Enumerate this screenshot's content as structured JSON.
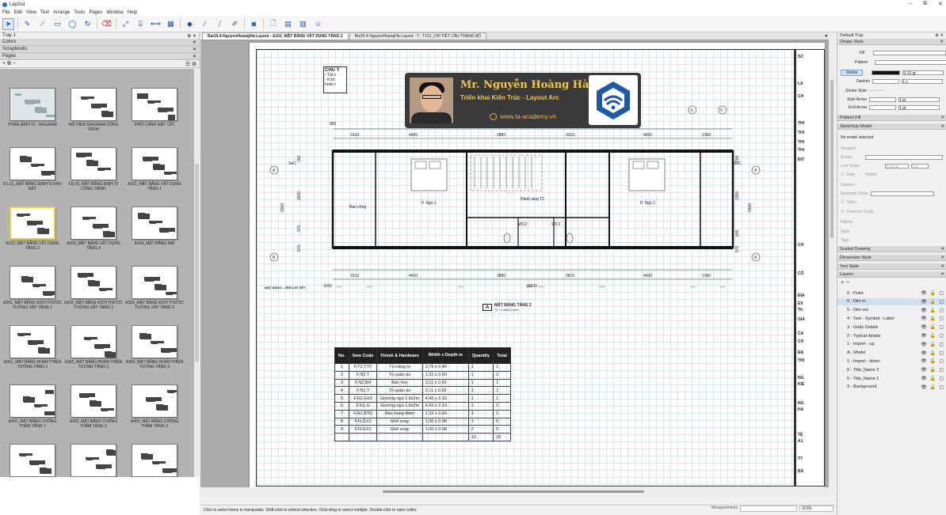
{
  "app": {
    "title": "LayOut"
  },
  "window_controls": {
    "minimize": "–",
    "restore": "⧉",
    "close": "✕"
  },
  "menu": [
    "File",
    "Edit",
    "View",
    "Text",
    "Arrange",
    "Tools",
    "Pages",
    "Window",
    "Help"
  ],
  "toolbar_icons": [
    "select-tool",
    "pencil-tool",
    "line-tool",
    "rectangle-tool",
    "circle-tool",
    "rotate-tool",
    "eraser-tool",
    "scale-tool",
    "label-tool",
    "dimension-tool",
    "table-tool",
    "style-tool",
    "sample-tool",
    "fill-tool",
    "paint-tool",
    "screen-tool",
    "add-page",
    "document",
    "document-2",
    "user-tool"
  ],
  "left_tray": {
    "title": "Tray 1",
    "sections": {
      "colors": "Colors",
      "scrapbooks": "Scrapbooks",
      "pages": "Pages"
    },
    "pages": [
      {
        "label": "PHÂN ĐỊNH VỊ - DIAGRAM"
      },
      {
        "label": "MÔ HÌNH DIAGRAM CÔNG TRÌNH"
      },
      {
        "label": "PHỐI CẢNH MẶT CẮT"
      },
      {
        "label": "D1.01_MẶT BẰNG ĐỊNH VỊ KHU ĐẤT"
      },
      {
        "label": "D2.01_MẶT BẰNG ĐỊNH VỊ CÔNG TRÌNH"
      },
      {
        "label": "A101_MẶT BẰNG VẬT DỤNG TẦNG 1"
      },
      {
        "label": "A102_MẶT BẰNG VẬT DỤNG TẦNG 2"
      },
      {
        "label": "A103_MẶT BẰNG VẬT DỤNG TẦNG 3"
      },
      {
        "label": "A104_MẶT BẰNG MÁI"
      },
      {
        "label": "A201_MẶT BẰNG KÍCH THƯỚC TƯỜNG XÂY TẦNG 1"
      },
      {
        "label": "A202_MẶT BẰNG KÍCH THƯỚC TƯỜNG XÂY TẦNG 2"
      },
      {
        "label": "A203_MẶT BẰNG KÍCH THƯỚC TƯỜNG XÂY TẦNG 3"
      },
      {
        "label": "A301_MẶT BẰNG HOÀN THIỆN TƯỜNG TẦNG 1"
      },
      {
        "label": "A302_MẶT BẰNG HOÀN THIỆN TƯỜNG TẦNG 2"
      },
      {
        "label": "A303_MẶT BẰNG HOÀN THIỆN TƯỜNG TẦNG 3"
      },
      {
        "label": "A401_MẶT BẰNG CHỐNG THẤM TẦNG 1"
      },
      {
        "label": "A402_MẶT BẰNG CHỐNG THẤM TẦNG 2"
      },
      {
        "label": "A403_MẶT BẰNG CHỐNG THẤM TẦNG 3"
      },
      {
        "label": ""
      },
      {
        "label": ""
      },
      {
        "label": ""
      }
    ]
  },
  "tabs": [
    {
      "label": "Bai15.4-NguyenHoangHa-Layout - A102_MẶT BẰNG VẬT DỤNG TẦNG 2"
    },
    {
      "label": "Bai15.4-NguyenHoangHa-Layout - T - T101_CHI TIẾT CẦU THANG BỘ"
    }
  ],
  "banner": {
    "name": "Mr. Nguyễn Hoàng Hà",
    "subtitle": "Triển khai Kiến Trúc - Layout Arc",
    "website": "www.ta-academy.vn"
  },
  "chu_y": {
    "title": "CHÚ Ý",
    "lines": [
      "- Tất c",
      "- Kích",
      "hoàn t"
    ]
  },
  "plan": {
    "top_dims": [
      "1510",
      "4420",
      "3880",
      "3010",
      "4420",
      "1360"
    ],
    "bottom_dims": [
      "1510",
      "4420",
      "3880",
      "3810",
      "4420",
      "1360"
    ],
    "total_left": "860",
    "total_top": "18600",
    "total_bottom": "18600",
    "total_left_bottom": "1160",
    "left_dims": [
      "750",
      "2600",
      "970",
      "570"
    ],
    "right_dims": [
      "600",
      "3360",
      "600",
      "570"
    ],
    "right_total": "5500",
    "left_total": "5500",
    "grid_top": [
      "5",
      "6",
      "6'"
    ],
    "grid_bottom": [
      "2'",
      "2",
      "3",
      "4",
      "5",
      "6",
      "6'"
    ],
    "rows": [
      "A",
      "B"
    ],
    "rooms": {
      "bedroom1": "P. Ngủ 1",
      "bedroom2": "P. Ngủ 2",
      "wc2": "WC2",
      "wc3": "WC3",
      "hallway": "Hành lang T2",
      "balcony": "Ban công",
      "section": "SeC"
    },
    "side_note": "MẶT BẰNG - XEM CHI TIẾT",
    "plan_title_letter": "A",
    "plan_title": "MẶT BẰNG TẦNG 2",
    "plan_scale": "TL: 1 over(1) mm"
  },
  "table": {
    "headers": [
      "No.",
      "Item Code",
      "Finish & Hardware",
      "Width x Depth m",
      "Quantity",
      "Total"
    ],
    "rows": [
      [
        "1",
        "F.T2.TTT",
        "Tủ trang trí",
        "2.76 x 0.40",
        "1",
        "1"
      ],
      [
        "2",
        "F.N2.T",
        "Tủ quần áo",
        "1.31 x 0.60",
        "1",
        "2"
      ],
      [
        "3",
        "F.N2.BH",
        "Bàn Học",
        "3.11 x 0.60",
        "1",
        "1"
      ],
      [
        "4",
        "F.N1.T",
        "Tủ quần áo",
        "3.11 x 0.60",
        "1",
        "1"
      ],
      [
        "5",
        "F.N1.G#2",
        "Giường ngủ 1.8x2m",
        "4.42 x 2.10",
        "1",
        "1"
      ],
      [
        "6",
        "F.N1.G",
        "Giường ngủ 1.8x2m",
        "4.42 x 2.10",
        "1",
        "2"
      ],
      [
        "7",
        "F.N1.BTD",
        "Bàn trang điểm",
        "1.32 x 0.60",
        "1",
        "1"
      ],
      [
        "8",
        "F.N.GX1",
        "Ghế xoay",
        "1.00 x 0.98",
        "1",
        "5"
      ],
      [
        "9",
        "F.N.GX1",
        "Ghế xoay",
        "1.00 x 0.98",
        "2",
        "5"
      ],
      [
        "",
        "",
        "",
        "",
        "10",
        "20"
      ]
    ]
  },
  "titleblock_labels": [
    "SC",
    "LA",
    "CH",
    "THI",
    "THI",
    "THI",
    "THI",
    "ĐƠ",
    "CH",
    "CÔ",
    "ĐỊA",
    "EX",
    "Th",
    "GIÁ",
    "CA",
    "CH",
    "ĐẠ",
    "THI",
    "NG",
    "KIỂ",
    "NG",
    "HA",
    "TÊ",
    "A1",
    "TY",
    "BẢ"
  ],
  "status": {
    "hint": "Click to select items to manipulate. Shift-click to extend selection. Click-drag to select multiple. Double-click to open editor.",
    "measurements_label": "Measurements",
    "zoom": "110%"
  },
  "right_tray": {
    "title": "Default Tray",
    "shape_style": "Shape Style",
    "fill": "Fill",
    "pattern": "Pattern",
    "stroke": "Stroke",
    "stroke_width": "0.15 pt",
    "dashes": "Dashes",
    "dash_scale": "1 x",
    "stroke_style": "Stroke Style",
    "start_arrow": "Start Arrow",
    "end_arrow": "End Arrow",
    "arrow_size": "1 pt",
    "pattern_fill": "Pattern Fill",
    "sketchup_model": "SketchUp Model",
    "no_model": "No model selected",
    "viewport": "Viewport",
    "scene": "Scene",
    "line_scale": "Line Scale",
    "line_scale_value": "0.10 pt",
    "line_scale_x": "1 x",
    "auto": "Auto",
    "hybrid": "Hybrid",
    "camera": "Camera",
    "standard_views": "Standard Views",
    "ortho": "Ortho",
    "preserve_scale": "Preserve Scale",
    "effects": "Effects",
    "style": "Style",
    "tags": "Tags",
    "scaled_drawing": "Scaled Drawing",
    "dimension_style": "Dimension Style",
    "text_style": "Text Style",
    "layers": "Layers",
    "layer_list": [
      {
        "name": "6 - Point"
      },
      {
        "name": "5 - Dim in",
        "selected": true
      },
      {
        "name": "5 - Dim out"
      },
      {
        "name": "4 - Text - Symbol - Label"
      },
      {
        "name": "3 - Grids Details"
      },
      {
        "name": "2 - Typical details"
      },
      {
        "name": "1 - Import - up"
      },
      {
        "name": "A - Model"
      },
      {
        "name": "1 - Import - down"
      },
      {
        "name": "0 - Title_Name 2"
      },
      {
        "name": "0 - Title_Name 1"
      },
      {
        "name": "0 - Background"
      }
    ]
  },
  "colors": {
    "accent": "#1e6fd0",
    "selected_page_border": "#e8d040",
    "banner_text": "#f2c84b"
  }
}
